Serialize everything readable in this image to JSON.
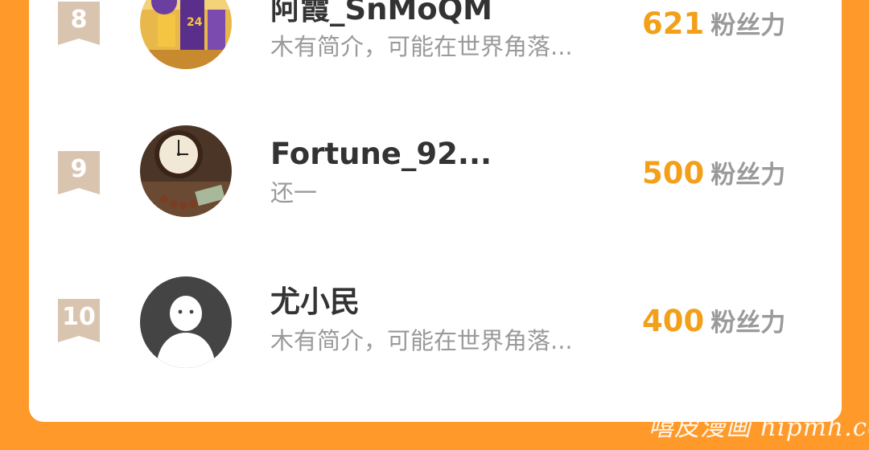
{
  "ranking": {
    "items": [
      {
        "rank": "8",
        "name": "阿霞_SnMoQM",
        "bio": "木有简介，可能在世界角落...",
        "score": "621",
        "unit": "粉丝力",
        "avatar_icon": "basketball-poster-avatar"
      },
      {
        "rank": "9",
        "name": "Fortune_92...",
        "bio": "还一",
        "score": "500",
        "unit": "粉丝力",
        "avatar_icon": "vintage-clock-avatar"
      },
      {
        "rank": "10",
        "name": "尤小民",
        "bio": "木有简介，可能在世界角落...",
        "score": "400",
        "unit": "粉丝力",
        "avatar_icon": "default-user-avatar"
      }
    ]
  },
  "watermark": "嘻皮漫画 hipmh.com",
  "colors": {
    "background": "#FF9A2A",
    "card": "#FFFFFF",
    "score": "#F2A019",
    "badge": "#D9C4B0",
    "name": "#333333",
    "muted": "#9A9A9A"
  }
}
